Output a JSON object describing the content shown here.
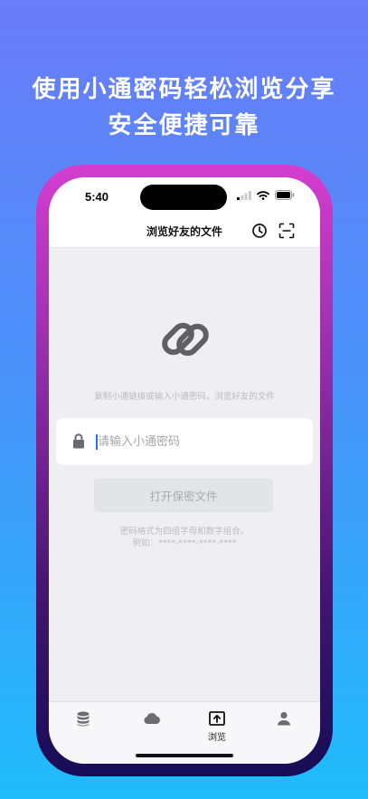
{
  "promo": {
    "line1": "使用小通密码轻松浏览分享",
    "line2": "安全便捷可靠"
  },
  "status_bar": {
    "time": "5:40"
  },
  "nav": {
    "title": "浏览好友的文件"
  },
  "main": {
    "hint": "复制小通链接或输入小通密码，浏览好友的文件",
    "password_placeholder": "请输入小通密码",
    "open_button_label": "打开保密文件",
    "format_line1": "密码格式为四组字母和数字组合。",
    "format_line2": "例如：****-****-****-****"
  },
  "tabs": [
    {
      "icon": "database-icon",
      "label": ""
    },
    {
      "icon": "cloud-icon",
      "label": ""
    },
    {
      "icon": "browse-icon",
      "label": "浏览",
      "active": true
    },
    {
      "icon": "person-icon",
      "label": ""
    }
  ],
  "colors": {
    "background_top": "#6a7bf7",
    "background_bottom": "#1fbcfb",
    "frame_top": "#d43ecf",
    "frame_bottom": "#160d55",
    "caret": "#2f6df6"
  }
}
